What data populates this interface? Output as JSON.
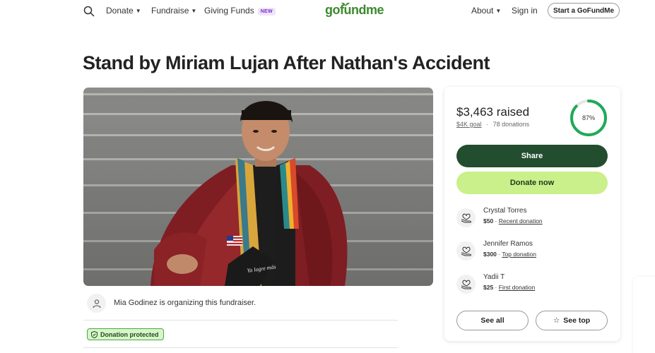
{
  "header": {
    "nav_left": [
      {
        "label": "Donate",
        "has_dropdown": true
      },
      {
        "label": "Fundraise",
        "has_dropdown": true
      },
      {
        "label": "Giving Funds",
        "badge": "NEW"
      }
    ],
    "logo": "gofundme",
    "nav_right": [
      {
        "label": "About",
        "has_dropdown": true
      },
      {
        "label": "Sign in"
      }
    ],
    "cta": "Start a GoFundMe"
  },
  "campaign": {
    "title": "Stand by Miriam Lujan After Nathan's Accident",
    "organizer_text": "Mia Godinez is organizing this fundraiser.",
    "protection_badge": "Donation protected"
  },
  "donation_card": {
    "raised": "$3,463 raised",
    "goal": "$4K goal",
    "separator": "·",
    "donations_count": "78 donations",
    "progress_label": "87%",
    "progress_fraction": 0.87,
    "share_label": "Share",
    "donate_label": "Donate now",
    "recent_donations": [
      {
        "name": "Crystal Torres",
        "amount": "$50",
        "type": "Recent donation"
      },
      {
        "name": "Jennifer Ramos",
        "amount": "$300",
        "type": "Top donation"
      },
      {
        "name": "Yadii T",
        "amount": "$25",
        "type": "First donation"
      }
    ],
    "see_all_label": "See all",
    "see_top_label": "See top"
  },
  "colors": {
    "brand_green": "#3c8a2e",
    "share_bg": "#234d2f",
    "donate_bg": "#c9f08a",
    "progress_ring": "#1faa59",
    "badge_purple_bg": "#efe4fb"
  },
  "icons": [
    "search-icon",
    "caret-down-icon",
    "heart-hand-icon",
    "shield-icon",
    "star-icon",
    "user-icon"
  ]
}
